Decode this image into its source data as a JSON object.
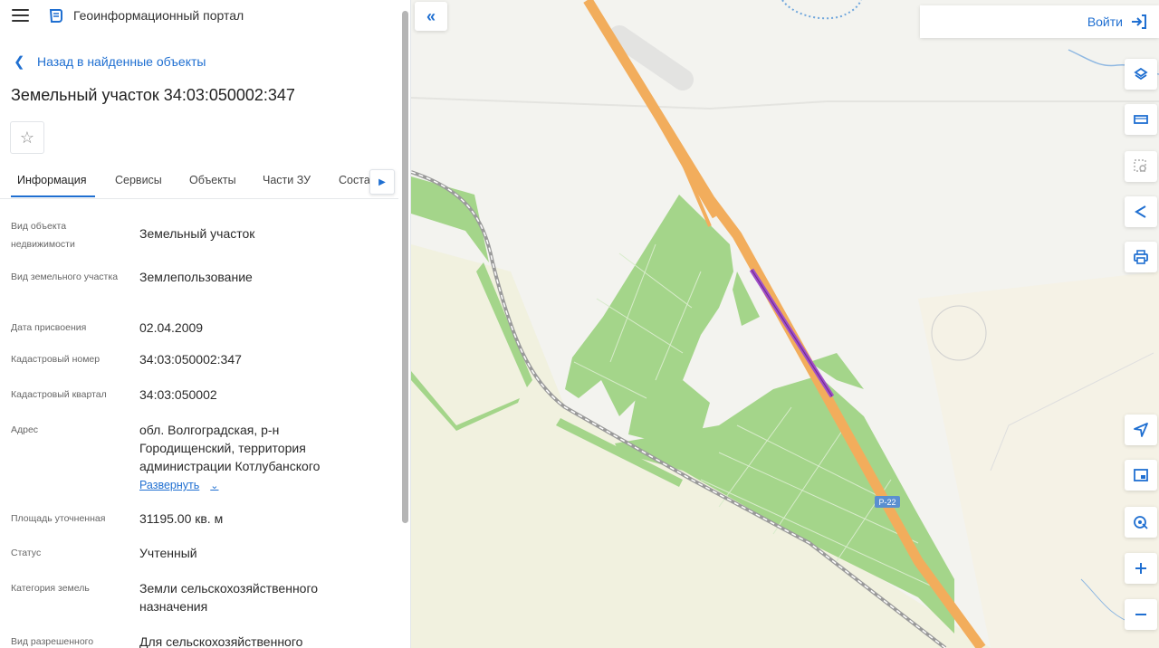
{
  "app": {
    "title": "Геоинформационный портал"
  },
  "nav": {
    "back_label": "Назад в найденные объекты"
  },
  "object": {
    "title": "Земельный участок 34:03:050002:347"
  },
  "tabs": [
    {
      "label": "Информация",
      "active": true
    },
    {
      "label": "Сервисы",
      "active": false
    },
    {
      "label": "Объекты",
      "active": false
    },
    {
      "label": "Части ЗУ",
      "active": false
    },
    {
      "label": "Состав",
      "active": false
    }
  ],
  "rows": [
    {
      "label": "Вид объекта недвижимости",
      "value": "Земельный участок"
    },
    {
      "label": "Вид земельного участка",
      "value": "Землепользование"
    },
    {
      "label": "Дата присвоения",
      "value": "02.04.2009"
    },
    {
      "label": "Кадастровый номер",
      "value": "34:03:050002:347"
    },
    {
      "label": "Кадастровый квартал",
      "value": "34:03:050002"
    },
    {
      "label": "Адрес",
      "value": "обл. Волгоградская, р-н Городищенский, территория администрации Котлубанского"
    },
    {
      "label": "Площадь уточненная",
      "value": "31195.00 кв. м"
    },
    {
      "label": "Статус",
      "value": "Учтенный"
    },
    {
      "label": "Категория земель",
      "value": "Земли сельскохозяйственного назначения"
    },
    {
      "label": "Вид разрешенного",
      "value": "Для сельскохозяйственного"
    }
  ],
  "address_expand_label": "Развернуть",
  "map": {
    "login_label": "Войти",
    "road_label": "Р-22",
    "colors": {
      "road": "#f2ad5c",
      "field": "#a4d58a",
      "parcel_highlight": "#a04fc8",
      "railway": "#8a8a8a",
      "accent": "#1f6fd1"
    }
  },
  "toolbar": {
    "icons": [
      "layers-icon",
      "ruler-icon",
      "select-area-icon",
      "share-icon",
      "print-icon",
      "locate-icon",
      "legend-icon",
      "geolocation-icon",
      "zoom-in-icon",
      "zoom-out-icon"
    ]
  }
}
